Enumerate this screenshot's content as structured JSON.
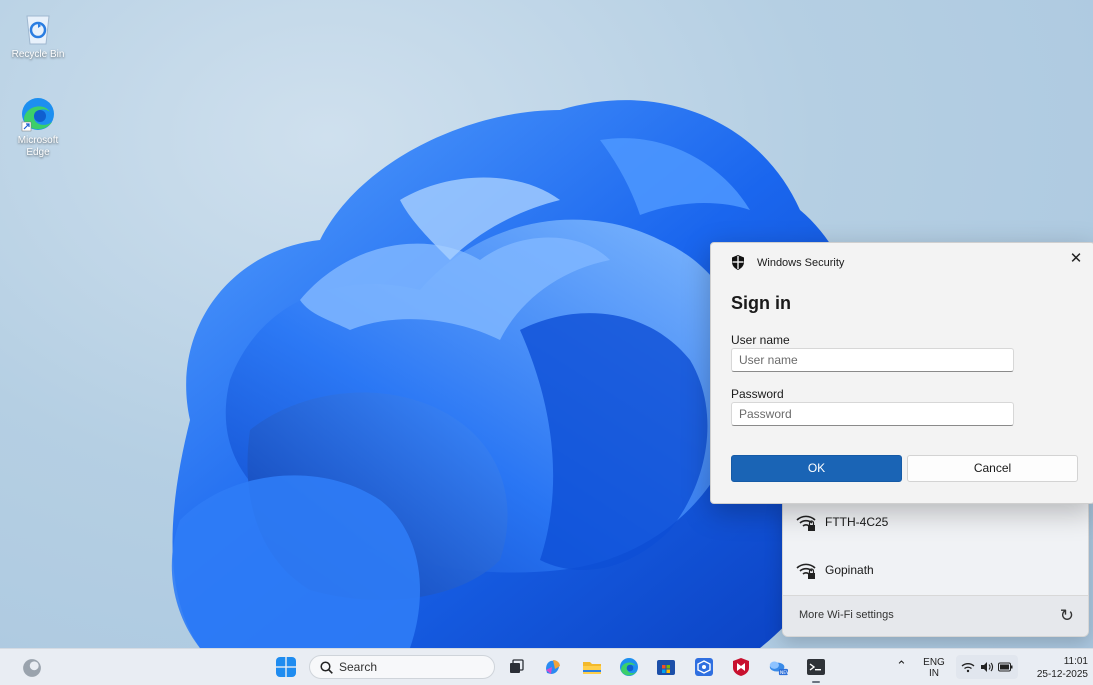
{
  "desktop": {
    "icons": [
      {
        "label": "Recycle Bin",
        "icon": "recycle-bin-icon"
      },
      {
        "label": "Microsoft Edge",
        "icon": "edge-icon"
      }
    ]
  },
  "dialog": {
    "app_name": "Windows Security",
    "title": "Sign in",
    "username_label": "User name",
    "username_placeholder": "User name",
    "username_value": "",
    "password_label": "Password",
    "password_placeholder": "Password",
    "password_value": "",
    "ok_label": "OK",
    "cancel_label": "Cancel",
    "close_glyph": "✕"
  },
  "wifi_flyout": {
    "networks": [
      {
        "name": "FTTH-4C25",
        "icon": "wifi-secured-icon"
      },
      {
        "name": "Gopinath",
        "icon": "wifi-secured-icon"
      }
    ],
    "more_settings": "More Wi-Fi settings"
  },
  "taskbar": {
    "search_label": "Search",
    "language_top": "ENG",
    "language_bottom": "IN",
    "time": "11:01",
    "date": "25-12-2025",
    "apps": [
      "start-icon",
      "task-view-icon",
      "copilot-icon",
      "file-explorer-icon",
      "edge-icon",
      "store-icon",
      "vscode-icon",
      "mcafee-icon",
      "weather-icon",
      "terminal-icon"
    ]
  },
  "colors": {
    "accent": "#1a64b5",
    "bloom": "#1f6ff0"
  }
}
